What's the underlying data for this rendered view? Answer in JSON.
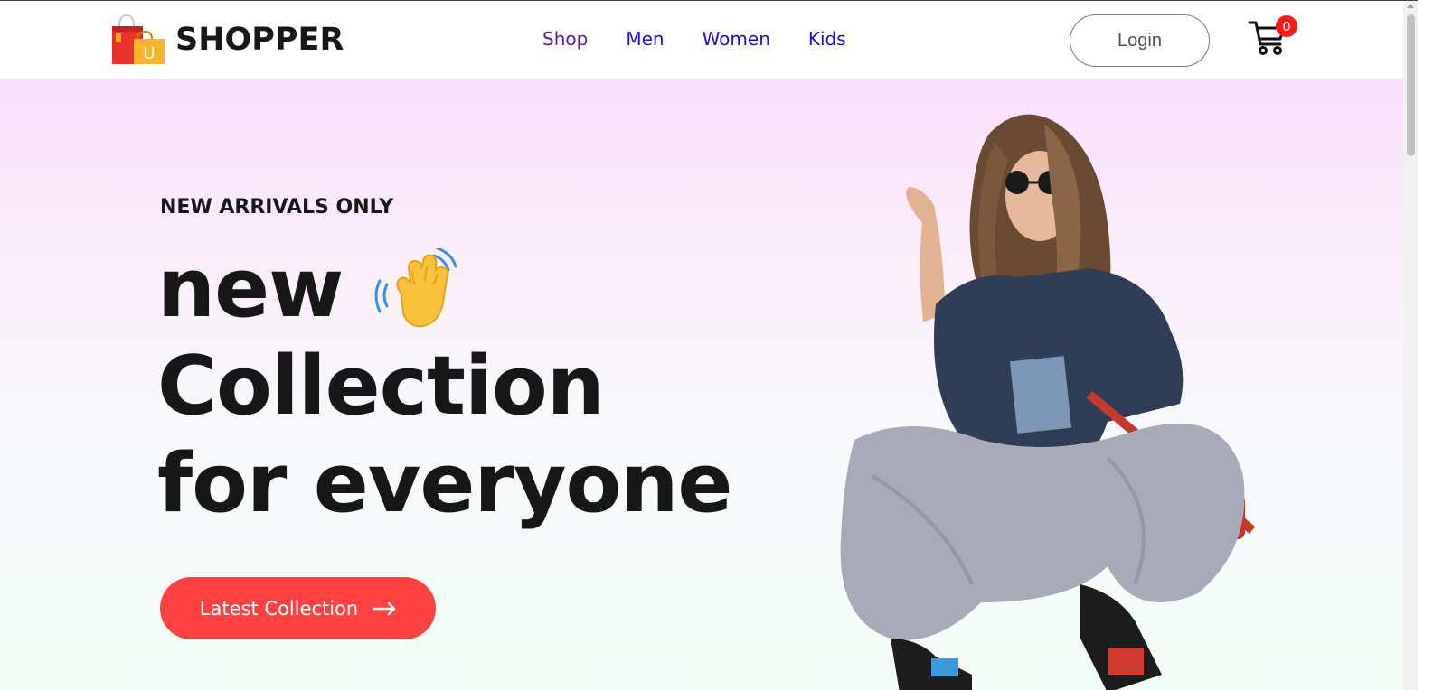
{
  "brand": {
    "name": "SHOPPER",
    "logo_icon": "shopping-bag-icon",
    "logo_letter": "U"
  },
  "nav": {
    "items": [
      {
        "label": "Shop"
      },
      {
        "label": "Men"
      },
      {
        "label": "Women"
      },
      {
        "label": "Kids"
      }
    ]
  },
  "header": {
    "login_label": "Login",
    "cart_icon": "cart-icon",
    "cart_count": "0"
  },
  "hero": {
    "tagline": "NEW ARRIVALS ONLY",
    "line1": "new",
    "line2": "Collection",
    "line3": "for everyone",
    "wave_icon": "waving-hand-icon",
    "cta_label": "Latest Collection",
    "cta_icon": "arrow-right-icon",
    "image": "model-photo"
  },
  "colors": {
    "accent": "#ff4141",
    "text": "#171717",
    "nav_link": "#1a0ed8",
    "nav_visited": "#5a1aa0",
    "badge": "#ff1a1a",
    "hero_top": "#fbdffd",
    "hero_bottom": "#f3fdf8"
  }
}
